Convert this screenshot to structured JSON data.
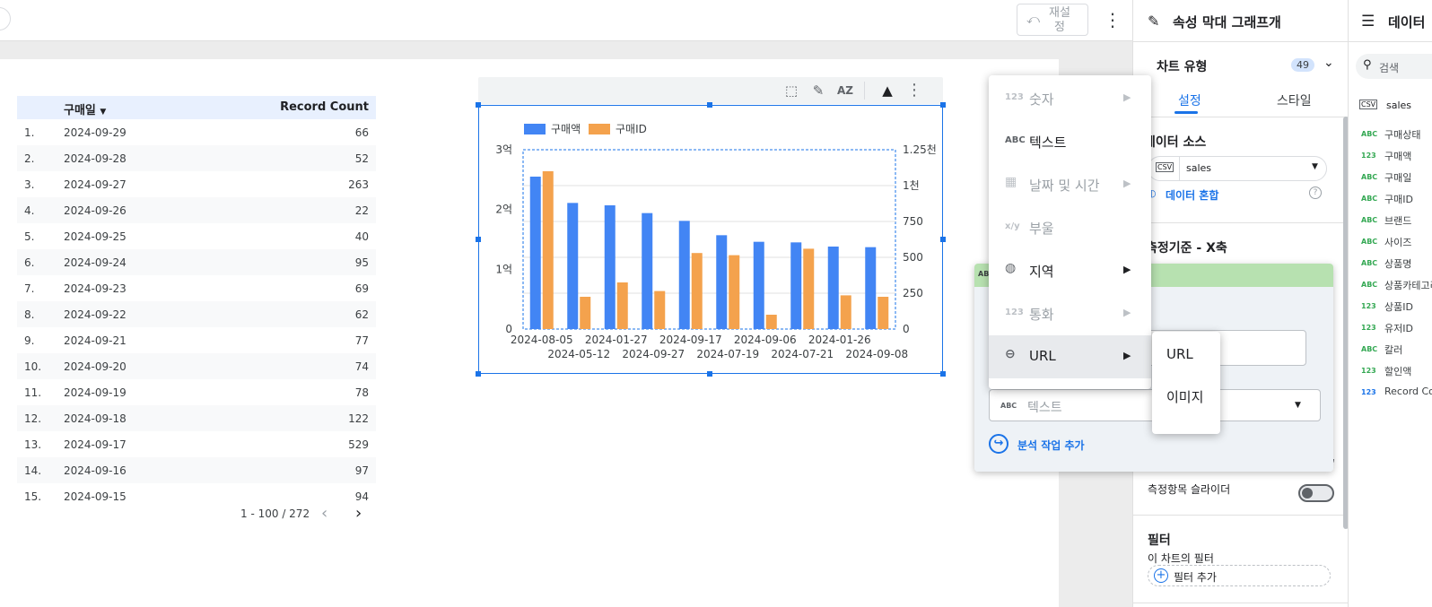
{
  "toolbar": {
    "reset_label": "재설 정"
  },
  "table": {
    "headers": {
      "date": "구매일",
      "count": "Record Count"
    },
    "rows": [
      {
        "n": "1.",
        "date": "2024-09-29",
        "count": "66"
      },
      {
        "n": "2.",
        "date": "2024-09-28",
        "count": "52"
      },
      {
        "n": "3.",
        "date": "2024-09-27",
        "count": "263"
      },
      {
        "n": "4.",
        "date": "2024-09-26",
        "count": "22"
      },
      {
        "n": "5.",
        "date": "2024-09-25",
        "count": "40"
      },
      {
        "n": "6.",
        "date": "2024-09-24",
        "count": "95"
      },
      {
        "n": "7.",
        "date": "2024-09-23",
        "count": "69"
      },
      {
        "n": "8.",
        "date": "2024-09-22",
        "count": "62"
      },
      {
        "n": "9.",
        "date": "2024-09-21",
        "count": "77"
      },
      {
        "n": "10.",
        "date": "2024-09-20",
        "count": "74"
      },
      {
        "n": "11.",
        "date": "2024-09-19",
        "count": "78"
      },
      {
        "n": "12.",
        "date": "2024-09-18",
        "count": "122"
      },
      {
        "n": "13.",
        "date": "2024-09-17",
        "count": "529"
      },
      {
        "n": "14.",
        "date": "2024-09-16",
        "count": "97"
      },
      {
        "n": "15.",
        "date": "2024-09-15",
        "count": "94"
      }
    ],
    "pager": "1 - 100 / 272"
  },
  "chart_data": {
    "type": "bar",
    "categories": [
      "2024-08-05",
      "2024-05-12",
      "2024-01-27",
      "2024-09-27",
      "2024-09-17",
      "2024-07-19",
      "2024-09-06",
      "2024-07-21",
      "2024-01-26",
      "2024-09-08"
    ],
    "series": [
      {
        "name": "구매액",
        "axis": "left",
        "color": "#4285f4",
        "values": [
          255000000,
          211000000,
          207000000,
          194000000,
          181000000,
          157000000,
          146000000,
          145000000,
          138000000,
          137000000
        ]
      },
      {
        "name": "구매ID",
        "axis": "right",
        "color": "#f4a24d",
        "values": [
          1100,
          225,
          325,
          265,
          530,
          515,
          100,
          560,
          235,
          225
        ]
      }
    ],
    "y_left": {
      "ylim": [
        0,
        300000000
      ],
      "tick_labels": [
        "0",
        "1억",
        "2억",
        "3억"
      ]
    },
    "y_right": {
      "ylim": [
        0,
        1250
      ],
      "tick_labels": [
        "0",
        "250",
        "500",
        "750",
        "1천",
        "1.25천"
      ]
    },
    "legend": "top-left",
    "grid": true
  },
  "type_menu": {
    "items": [
      {
        "icon": "123",
        "label": "숫자",
        "disabled": true,
        "submenu": true
      },
      {
        "icon": "ABC",
        "label": "텍스트",
        "disabled": false,
        "submenu": false
      },
      {
        "icon": "calendar-icon",
        "label": "날짜 및 시간",
        "disabled": true,
        "submenu": true
      },
      {
        "icon": "x/y",
        "label": "부울",
        "disabled": true,
        "submenu": false
      },
      {
        "icon": "globe-icon",
        "label": "지역",
        "disabled": false,
        "submenu": true
      },
      {
        "icon": "123",
        "label": "통화",
        "disabled": true,
        "submenu": true
      },
      {
        "icon": "link-icon",
        "label": "URL",
        "disabled": false,
        "submenu": true,
        "active": true
      }
    ]
  },
  "sub_menu": {
    "items": [
      "URL",
      "이미지"
    ]
  },
  "dim_popup": {
    "type_field_icon": "ABC",
    "type_field_value": "텍스트",
    "add_action": "분석 작업 추가"
  },
  "props": {
    "title": "속성 막대 그래프개",
    "chart_type_label": "차트 유형",
    "chart_type_badge": "49",
    "tab_setup": "설정",
    "tab_style": "스타일",
    "data_source_label": "데이터 소스",
    "data_source_value": "sales",
    "blend_label": "데이터 혼합",
    "dimension_label": "측정기준 - X축",
    "metric_slider_label": "측정항목 슬라이더",
    "filter_label": "필터",
    "chart_filter_label": "이 차트의 필터",
    "add_filter_label": "필터 추가"
  },
  "data_panel": {
    "title": "데이터",
    "search_placeholder": "검색",
    "source": "sales",
    "fields": [
      {
        "type": "ABC",
        "name": "구매상태"
      },
      {
        "type": "123",
        "name": "구매액"
      },
      {
        "type": "ABC",
        "name": "구매일"
      },
      {
        "type": "ABC",
        "name": "구매ID"
      },
      {
        "type": "ABC",
        "name": "브랜드"
      },
      {
        "type": "ABC",
        "name": "사이즈"
      },
      {
        "type": "ABC",
        "name": "상품명"
      },
      {
        "type": "ABC",
        "name": "상품카테고리"
      },
      {
        "type": "123",
        "name": "상품ID"
      },
      {
        "type": "123",
        "name": "유저ID"
      },
      {
        "type": "ABC",
        "name": "칼러"
      },
      {
        "type": "123",
        "name": "할인액"
      },
      {
        "type": "123",
        "name": "Record Count"
      }
    ]
  }
}
